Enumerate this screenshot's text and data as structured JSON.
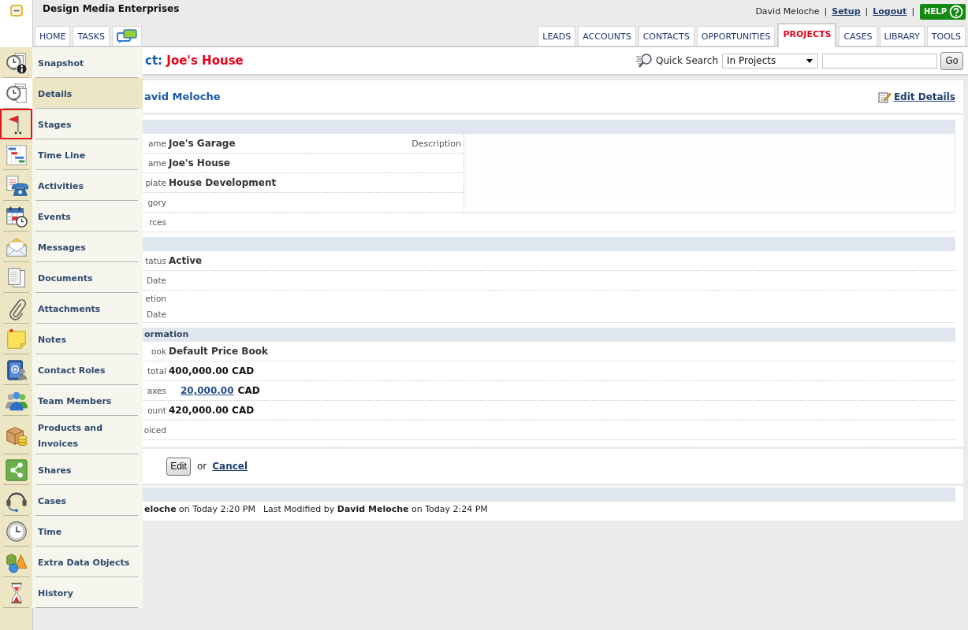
{
  "header": {
    "company": "Design Media Enterprises",
    "user_bar": [
      {
        "kind": "text",
        "text": "David Meloche"
      },
      {
        "kind": "separator",
        "text": "|"
      },
      {
        "kind": "link",
        "text": "Setup"
      },
      {
        "kind": "separator",
        "text": "|"
      },
      {
        "kind": "link",
        "text": "Logout"
      },
      {
        "kind": "separator",
        "text": "|"
      }
    ],
    "help_button": {
      "label": "HELP"
    }
  },
  "left_tabs": [
    "HOME",
    "TASKS"
  ],
  "module_tabs": [
    {
      "label": "LEADS",
      "selected": false
    },
    {
      "label": "ACCOUNTS",
      "selected": false
    },
    {
      "label": "CONTACTS",
      "selected": false
    },
    {
      "label": "OPPORTUNITIES",
      "selected": false
    },
    {
      "label": "PROJECTS",
      "selected": true
    },
    {
      "label": "CASES",
      "selected": false
    },
    {
      "label": "LIBRARY",
      "selected": false
    },
    {
      "label": "TOOLS",
      "selected": false
    }
  ],
  "nav_items": [
    {
      "label": "Snapshot",
      "selected": false,
      "highlighted": false
    },
    {
      "label": "Details",
      "selected": true,
      "highlighted": false
    },
    {
      "label": "Stages",
      "selected": false,
      "highlighted": true
    },
    {
      "label": "Time Line",
      "selected": false,
      "highlighted": false
    },
    {
      "label": "Activities",
      "selected": false,
      "highlighted": false
    },
    {
      "label": "Events",
      "selected": false,
      "highlighted": false
    },
    {
      "label": "Messages",
      "selected": false,
      "highlighted": false
    },
    {
      "label": "Documents",
      "selected": false,
      "highlighted": false
    },
    {
      "label": "Attachments",
      "selected": false,
      "highlighted": false
    },
    {
      "label": "Notes",
      "selected": false,
      "highlighted": false
    },
    {
      "label": "Contact Roles",
      "selected": false,
      "highlighted": false
    },
    {
      "label": "Team Members",
      "selected": false,
      "highlighted": false
    },
    {
      "label": "Products and Invoices",
      "selected": false,
      "highlighted": false
    },
    {
      "label": "Shares",
      "selected": false,
      "highlighted": false
    },
    {
      "label": "Cases",
      "selected": false,
      "highlighted": false
    },
    {
      "label": "Time",
      "selected": false,
      "highlighted": false
    },
    {
      "label": "Extra Data Objects",
      "selected": false,
      "highlighted": false
    },
    {
      "label": "History",
      "selected": false,
      "highlighted": false
    }
  ],
  "page_title": {
    "lead": "ct:",
    "project": "Joe's House"
  },
  "quick_search": {
    "label": "Quick Search",
    "scope": "In Projects",
    "button": "Go"
  },
  "owner": {
    "name": "avid Meloche",
    "edit_link": "Edit Details"
  },
  "sections": [
    {
      "kind": "details",
      "description_label": "Description",
      "fields": [
        {
          "label": "ame",
          "kind": "text",
          "value": "Joe's Garage"
        },
        {
          "label": "ame",
          "kind": "text",
          "value": "Joe's House"
        },
        {
          "label": "plate",
          "kind": "text",
          "value": "House Development"
        },
        {
          "label": "gory",
          "kind": "empty"
        }
      ],
      "wide_fields": [
        {
          "label": "rces"
        }
      ]
    },
    {
      "kind": "plain",
      "fields": [
        {
          "label": "tatus",
          "kind": "text",
          "value": "Active"
        },
        {
          "label": "Date",
          "kind": "empty"
        },
        {
          "label": "etion Date",
          "kind": "empty"
        }
      ]
    },
    {
      "kind": "plain",
      "title": "ormation",
      "fields": [
        {
          "label": "ook",
          "kind": "text",
          "value": "Default Price Book"
        },
        {
          "label": "total",
          "kind": "amount",
          "value": "400,000.00 CAD"
        },
        {
          "label": "axes",
          "kind": "link_amount",
          "value": "20,000.00",
          "suffix": "CAD"
        },
        {
          "label": "ount",
          "kind": "amount",
          "value": "420,000.00 CAD"
        },
        {
          "label": "oiced",
          "kind": "empty"
        }
      ]
    }
  ],
  "actions": {
    "button": "Edit",
    "joiner": "or",
    "link": "Cancel"
  },
  "history": {
    "created": "**eloche** on Today 2:20 PM",
    "modified": "Last Modified by **David Meloche** on Today 2:24 PM"
  }
}
